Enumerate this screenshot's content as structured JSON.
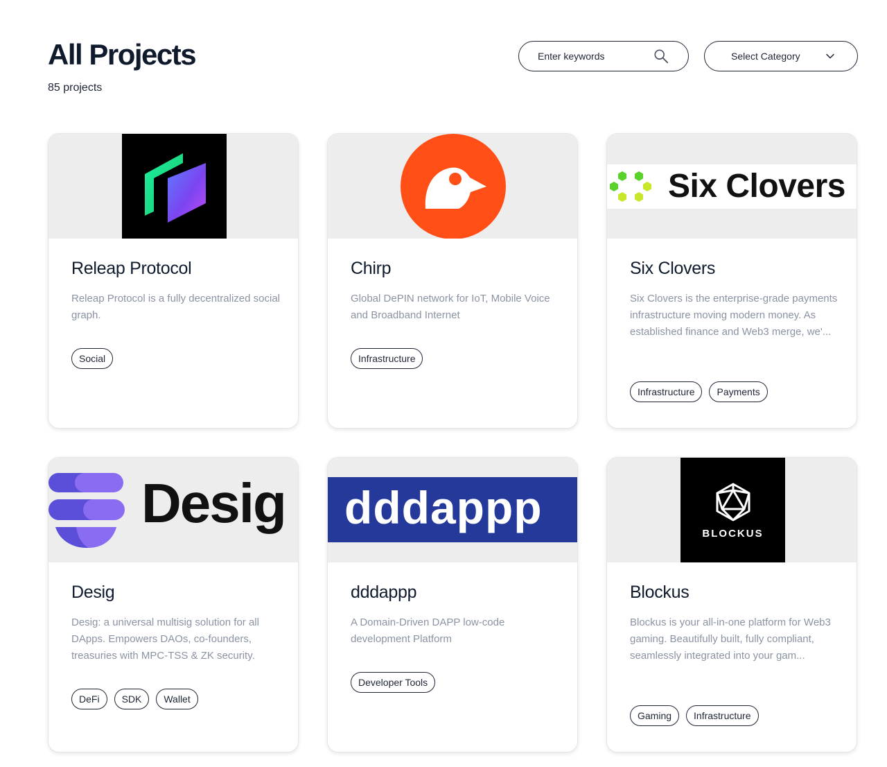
{
  "header": {
    "title": "All Projects",
    "count_text": "85 projects",
    "search_placeholder": "Enter keywords",
    "category_label": "Select Category"
  },
  "projects": [
    {
      "name": "Releap Protocol",
      "description": "Releap Protocol is a fully decentralized social graph.",
      "tags": [
        "Social"
      ]
    },
    {
      "name": "Chirp",
      "description": "Global DePIN network for IoT, Mobile Voice and Broadband Internet",
      "tags": [
        "Infrastructure"
      ]
    },
    {
      "name": "Six Clovers",
      "logo_text": "Six Clovers",
      "description": "Six Clovers is the enterprise-grade payments infrastructure moving modern money. As established finance and Web3 merge, we'...",
      "tags": [
        "Infrastructure",
        "Payments"
      ]
    },
    {
      "name": "Desig",
      "logo_text": "Desig",
      "description": "Desig: a universal multisig solution for all DApps. Empowers DAOs, co-founders, treasuries with MPC-TSS & ZK security.",
      "tags": [
        "DeFi",
        "SDK",
        "Wallet"
      ]
    },
    {
      "name": "dddappp",
      "logo_text": "dddappp",
      "description": "A Domain-Driven DAPP low-code development Platform",
      "tags": [
        "Developer Tools"
      ]
    },
    {
      "name": "Blockus",
      "logo_text": "BLOCKUS",
      "description": "Blockus is your all-in-one platform for Web3 gaming. Beautifully built, fully compliant, seamlessly integrated into your gam...",
      "tags": [
        "Gaming",
        "Infrastructure"
      ]
    }
  ],
  "colors": {
    "chirp_orange": "#ff4f17",
    "releap_bg": "#000000",
    "dddappp_blue": "#24399a",
    "desig_purple": "#6c5ce7",
    "clover_green": "#5bd12b",
    "clover_yellow": "#c8e62a"
  }
}
